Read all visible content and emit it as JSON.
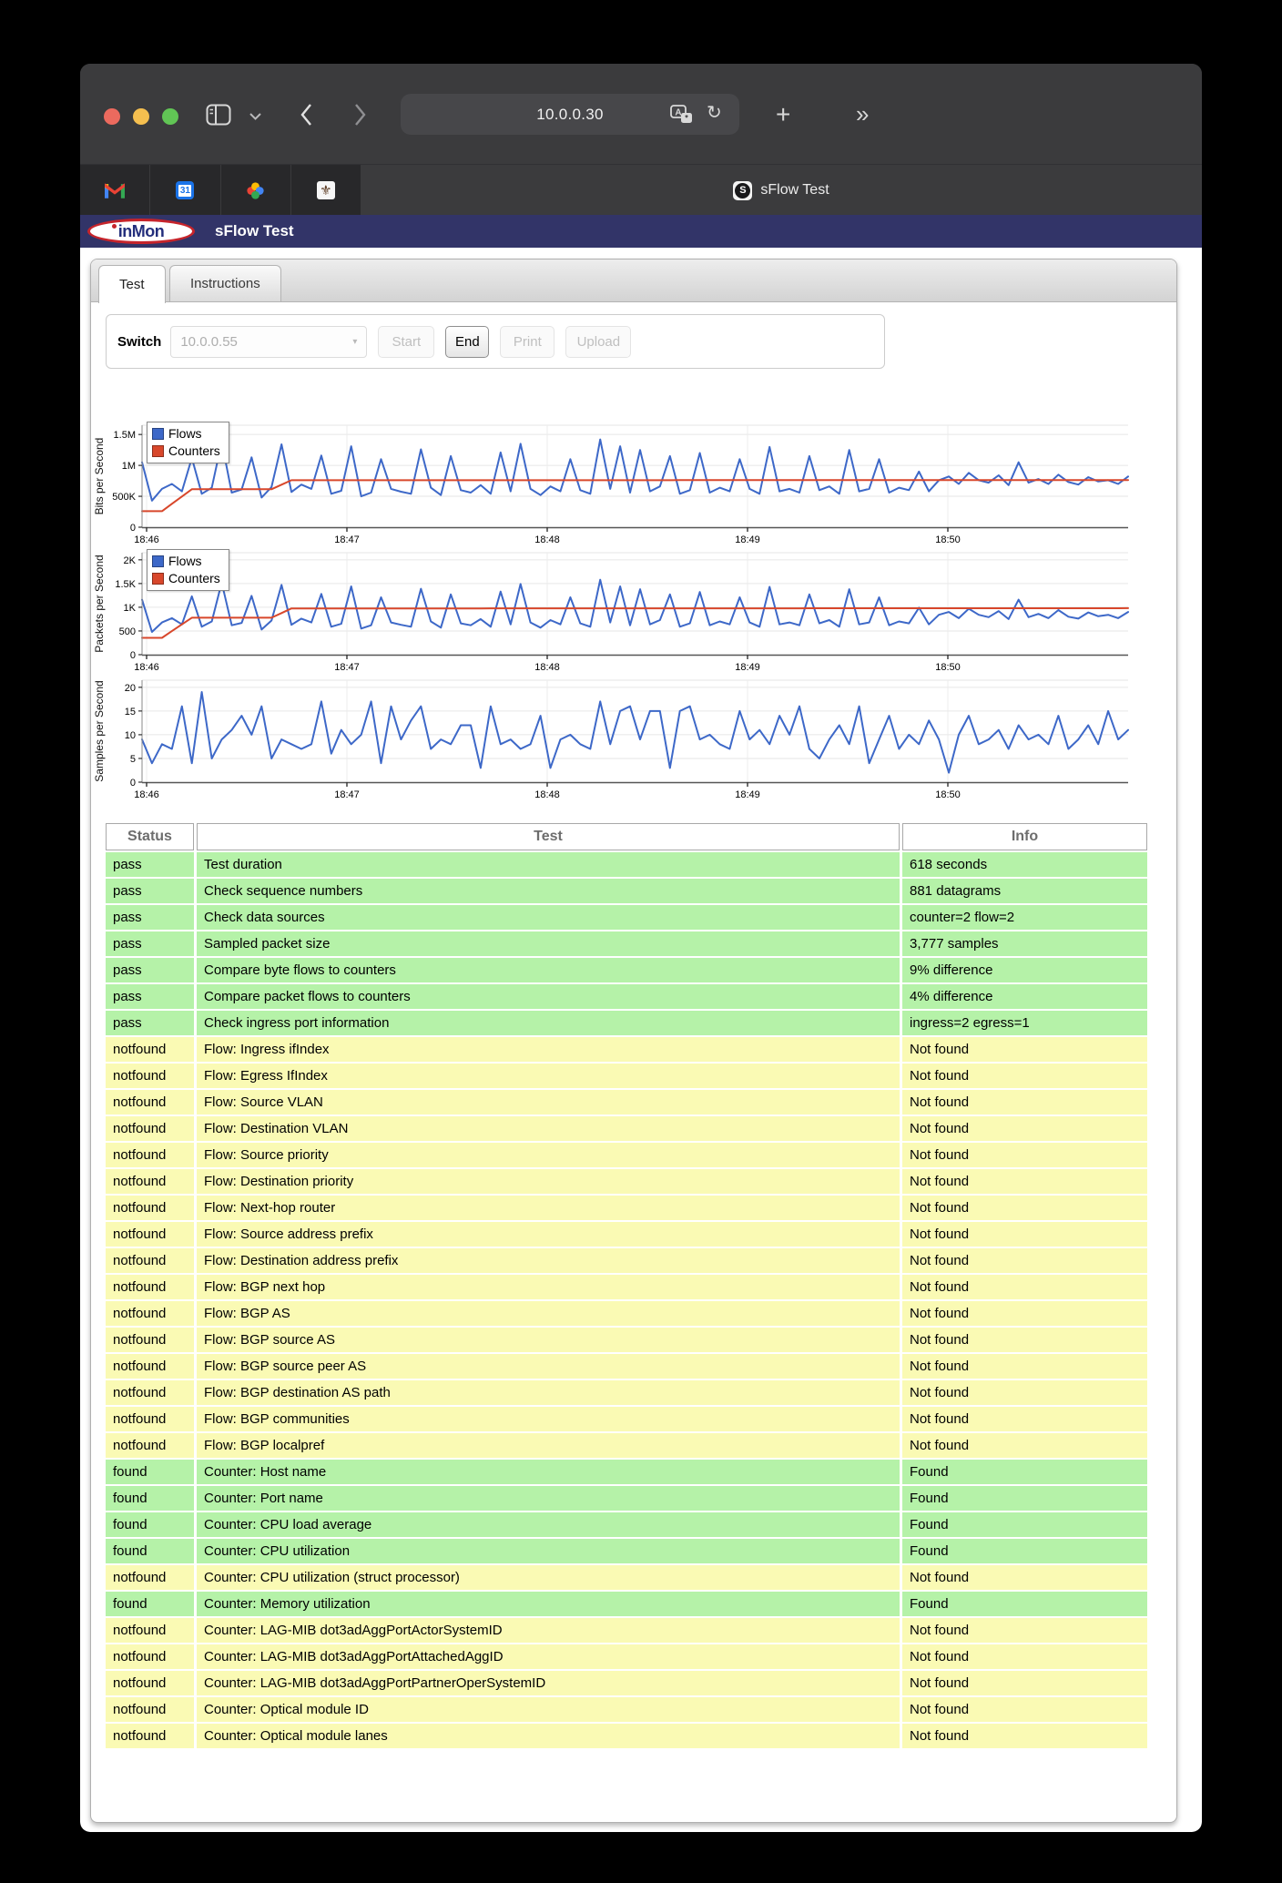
{
  "browser": {
    "url": "10.0.0.30",
    "tab_title": "sFlow Test",
    "pinned_tab_icons": [
      "gmail-icon",
      "calendar-icon",
      "photos-icon",
      "fleur-de-lis-icon"
    ]
  },
  "icons": {
    "back": "‹",
    "forward": "›",
    "reload": "↻",
    "plus": "+",
    "overflow": "»",
    "caret": "▾",
    "fleur": "⚜",
    "s_badge": "S",
    "calendar_day": "31"
  },
  "colors": {
    "traffic_red": "#ec6a5e",
    "traffic_yellow": "#f5bf4f",
    "traffic_green": "#61c555",
    "header_navy": "#323468",
    "pass_row": "#b5f2a8",
    "notfound_row": "#fafab4",
    "flows_line": "#3d68c8",
    "counters_line": "#d8472b"
  },
  "site": {
    "brand": "inMon",
    "header_title": "sFlow Test"
  },
  "tabs": {
    "test": "Test",
    "instructions": "Instructions"
  },
  "controls": {
    "switch_label": "Switch",
    "switch_value": "10.0.0.55",
    "start": "Start",
    "end": "End",
    "print": "Print",
    "upload": "Upload"
  },
  "chart_data": [
    {
      "type": "line",
      "ylabel": "Bits per Second",
      "x_ticks": [
        "18:46",
        "18:47",
        "18:48",
        "18:49",
        "18:50"
      ],
      "y_ticks": [
        [
          0,
          "0"
        ],
        [
          500,
          "500K"
        ],
        [
          1000,
          "1M"
        ],
        [
          1500,
          "1.5M"
        ]
      ],
      "y_max": 1650,
      "unit": "Kbps",
      "legend": [
        "Flows",
        "Counters"
      ],
      "series": [
        {
          "name": "Flows",
          "color": "#3d68c8",
          "values": [
            1050,
            430,
            620,
            700,
            580,
            1120,
            540,
            640,
            1380,
            560,
            610,
            1130,
            480,
            650,
            1340,
            570,
            690,
            620,
            1160,
            540,
            590,
            1310,
            500,
            560,
            1100,
            620,
            575,
            540,
            1260,
            640,
            520,
            1150,
            600,
            560,
            680,
            540,
            1210,
            580,
            1350,
            620,
            520,
            660,
            580,
            1100,
            600,
            540,
            1420,
            620,
            1310,
            560,
            1250,
            580,
            660,
            1150,
            540,
            600,
            1200,
            560,
            640,
            580,
            1100,
            620,
            540,
            1300,
            580,
            620,
            560,
            1150,
            600,
            660,
            540,
            1250,
            580,
            620,
            1100,
            560,
            640,
            600,
            900,
            580,
            760,
            820,
            700,
            880,
            760,
            720,
            840,
            680,
            1050,
            720,
            780,
            700,
            850,
            730,
            690,
            810,
            740,
            760,
            700,
            820
          ]
        },
        {
          "name": "Counters",
          "color": "#d8472b",
          "breakpoints": [
            [
              0,
              260
            ],
            [
              2,
              260
            ],
            [
              5,
              615
            ],
            [
              13,
              615
            ],
            [
              15,
              760
            ],
            [
              99,
              762
            ]
          ]
        }
      ]
    },
    {
      "type": "line",
      "ylabel": "Packets per Second",
      "x_ticks": [
        "18:46",
        "18:47",
        "18:48",
        "18:49",
        "18:50"
      ],
      "y_ticks": [
        [
          0,
          "0"
        ],
        [
          500,
          "500"
        ],
        [
          1000,
          "1K"
        ],
        [
          1500,
          "1.5K"
        ],
        [
          2000,
          "2K"
        ]
      ],
      "y_max": 2150,
      "unit": "packets/s",
      "legend": [
        "Flows",
        "Counters"
      ],
      "series": [
        {
          "name": "Flows",
          "color": "#3d68c8",
          "values": [
            1160,
            480,
            680,
            770,
            640,
            1230,
            590,
            700,
            1520,
            620,
            670,
            1240,
            530,
            720,
            1470,
            630,
            760,
            680,
            1280,
            590,
            650,
            1440,
            550,
            620,
            1210,
            680,
            630,
            590,
            1390,
            700,
            570,
            1270,
            660,
            620,
            750,
            590,
            1330,
            640,
            1490,
            680,
            570,
            730,
            640,
            1210,
            660,
            590,
            1580,
            680,
            1440,
            620,
            1380,
            640,
            730,
            1270,
            590,
            660,
            1320,
            620,
            700,
            640,
            1210,
            680,
            590,
            1430,
            640,
            680,
            620,
            1270,
            660,
            730,
            590,
            1380,
            640,
            680,
            1210,
            620,
            700,
            660,
            990,
            640,
            840,
            900,
            770,
            970,
            840,
            790,
            920,
            750,
            1160,
            790,
            860,
            770,
            940,
            800,
            760,
            890,
            810,
            840,
            770,
            900
          ]
        },
        {
          "name": "Counters",
          "color": "#d8472b",
          "breakpoints": [
            [
              0,
              355
            ],
            [
              2,
              355
            ],
            [
              5,
              780
            ],
            [
              13,
              780
            ],
            [
              15,
              975
            ],
            [
              99,
              980
            ]
          ]
        }
      ]
    },
    {
      "type": "line",
      "ylabel": "Samples per Second",
      "x_ticks": [
        "18:46",
        "18:47",
        "18:48",
        "18:49",
        "18:50"
      ],
      "y_ticks": [
        [
          0,
          "0"
        ],
        [
          5,
          "5"
        ],
        [
          10,
          "10"
        ],
        [
          15,
          "15"
        ],
        [
          20,
          "20"
        ]
      ],
      "y_max": 21.5,
      "unit": "samples/s",
      "legend": null,
      "series": [
        {
          "name": "Samples",
          "color": "#3d68c8",
          "values": [
            9,
            4,
            8,
            7,
            16,
            4,
            19,
            5,
            9,
            11,
            14,
            10,
            16,
            5,
            9,
            8,
            7,
            8,
            17,
            6,
            11,
            8,
            10,
            17,
            4,
            16,
            9,
            13,
            16,
            7,
            9,
            8,
            12,
            12,
            3,
            16,
            8,
            9,
            7,
            8,
            14,
            3,
            9,
            10,
            8,
            7,
            17,
            8,
            15,
            16,
            9,
            15,
            15,
            3,
            15,
            16,
            9,
            10,
            8,
            7,
            15,
            9,
            11,
            8,
            14,
            10,
            16,
            7,
            5,
            9,
            12,
            8,
            16,
            4,
            9,
            14,
            7,
            10,
            8,
            13,
            9,
            2,
            10,
            14,
            8,
            9,
            11,
            7,
            12,
            9,
            10,
            8,
            14,
            7,
            9,
            12,
            8,
            15,
            9,
            11
          ]
        }
      ]
    }
  ],
  "results": {
    "columns": [
      "Status",
      "Test",
      "Info"
    ],
    "rows": [
      {
        "status": "pass",
        "test": "Test duration",
        "info": "618 seconds"
      },
      {
        "status": "pass",
        "test": "Check sequence numbers",
        "info": "881 datagrams"
      },
      {
        "status": "pass",
        "test": "Check data sources",
        "info": "counter=2 flow=2"
      },
      {
        "status": "pass",
        "test": "Sampled packet size",
        "info": "3,777 samples"
      },
      {
        "status": "pass",
        "test": "Compare byte flows to counters",
        "info": "9% difference"
      },
      {
        "status": "pass",
        "test": "Compare packet flows to counters",
        "info": "4% difference"
      },
      {
        "status": "pass",
        "test": "Check ingress port information",
        "info": "ingress=2 egress=1"
      },
      {
        "status": "notfound",
        "test": "Flow: Ingress ifIndex",
        "info": "Not found"
      },
      {
        "status": "notfound",
        "test": "Flow: Egress IfIndex",
        "info": "Not found"
      },
      {
        "status": "notfound",
        "test": "Flow: Source VLAN",
        "info": "Not found"
      },
      {
        "status": "notfound",
        "test": "Flow: Destination VLAN",
        "info": "Not found"
      },
      {
        "status": "notfound",
        "test": "Flow: Source priority",
        "info": "Not found"
      },
      {
        "status": "notfound",
        "test": "Flow: Destination priority",
        "info": "Not found"
      },
      {
        "status": "notfound",
        "test": "Flow: Next-hop router",
        "info": "Not found"
      },
      {
        "status": "notfound",
        "test": "Flow: Source address prefix",
        "info": "Not found"
      },
      {
        "status": "notfound",
        "test": "Flow: Destination address prefix",
        "info": "Not found"
      },
      {
        "status": "notfound",
        "test": "Flow: BGP next hop",
        "info": "Not found"
      },
      {
        "status": "notfound",
        "test": "Flow: BGP AS",
        "info": "Not found"
      },
      {
        "status": "notfound",
        "test": "Flow: BGP source AS",
        "info": "Not found"
      },
      {
        "status": "notfound",
        "test": "Flow: BGP source peer AS",
        "info": "Not found"
      },
      {
        "status": "notfound",
        "test": "Flow: BGP destination AS path",
        "info": "Not found"
      },
      {
        "status": "notfound",
        "test": "Flow: BGP communities",
        "info": "Not found"
      },
      {
        "status": "notfound",
        "test": "Flow: BGP localpref",
        "info": "Not found"
      },
      {
        "status": "found",
        "test": "Counter: Host name",
        "info": "Found"
      },
      {
        "status": "found",
        "test": "Counter: Port name",
        "info": "Found"
      },
      {
        "status": "found",
        "test": "Counter: CPU load average",
        "info": "Found"
      },
      {
        "status": "found",
        "test": "Counter: CPU utilization",
        "info": "Found"
      },
      {
        "status": "notfound",
        "test": "Counter: CPU utilization (struct processor)",
        "info": "Not found"
      },
      {
        "status": "found",
        "test": "Counter: Memory utilization",
        "info": "Found"
      },
      {
        "status": "notfound",
        "test": "Counter: LAG-MIB dot3adAggPortActorSystemID",
        "info": "Not found"
      },
      {
        "status": "notfound",
        "test": "Counter: LAG-MIB dot3adAggPortAttachedAggID",
        "info": "Not found"
      },
      {
        "status": "notfound",
        "test": "Counter: LAG-MIB dot3adAggPortPartnerOperSystemID",
        "info": "Not found"
      },
      {
        "status": "notfound",
        "test": "Counter: Optical module ID",
        "info": "Not found"
      },
      {
        "status": "notfound",
        "test": "Counter: Optical module lanes",
        "info": "Not found"
      }
    ]
  }
}
